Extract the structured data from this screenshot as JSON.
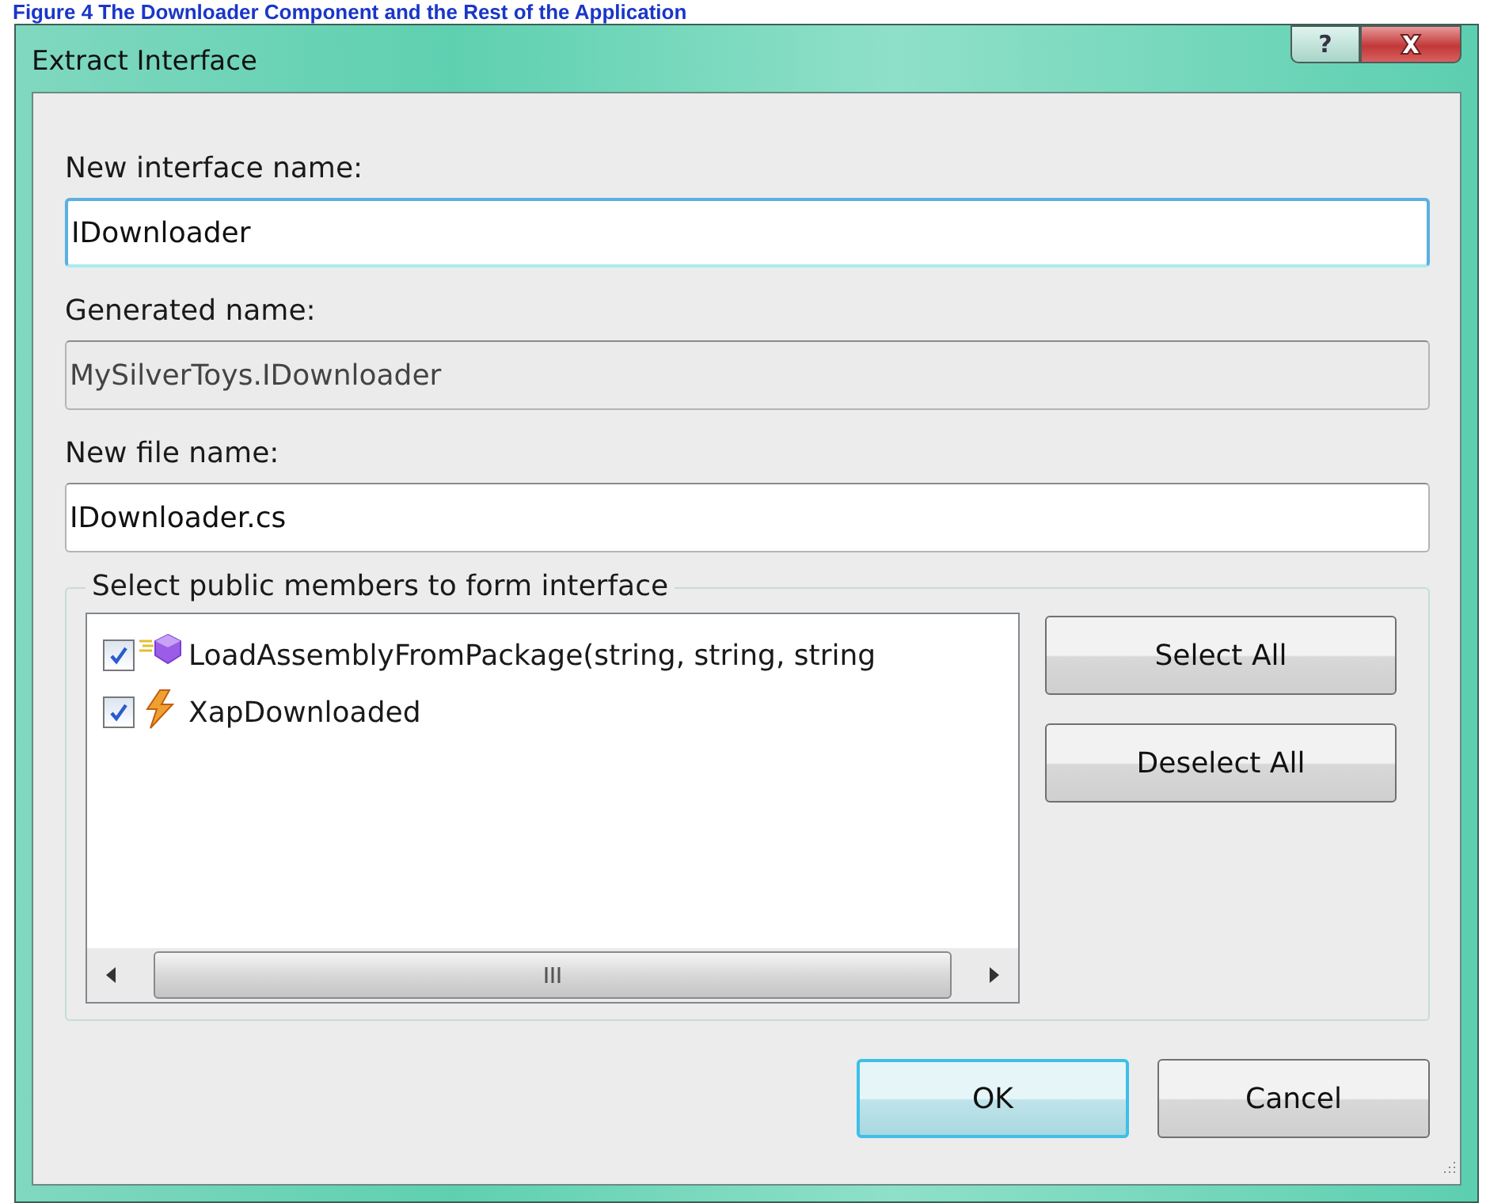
{
  "caption": "Figure 4 The Downloader Component and the Rest of the Application",
  "window": {
    "title": "Extract Interface",
    "title_buttons": [
      {
        "kind": "help",
        "label": "?"
      },
      {
        "kind": "close"
      }
    ]
  },
  "fields": [
    {
      "label": "New interface name:",
      "value": "IDownloader",
      "focused": true,
      "readonly": false
    },
    {
      "label": "Generated name:",
      "value": "MySilverToys.IDownloader",
      "focused": false,
      "readonly": true
    },
    {
      "label": "New file name:",
      "value": "IDownloader.cs",
      "focused": false,
      "readonly": false
    }
  ],
  "members": {
    "legend": "Select public members to form interface",
    "items": [
      {
        "label": "LoadAssemblyFromPackage(string, string, string",
        "kind": "method",
        "checked": true
      },
      {
        "label": "XapDownloaded",
        "kind": "event",
        "checked": true
      }
    ],
    "buttons": [
      "Select All",
      "Deselect All"
    ]
  },
  "footer_buttons": [
    {
      "label": "OK",
      "default": true
    },
    {
      "label": "Cancel",
      "default": false
    }
  ]
}
